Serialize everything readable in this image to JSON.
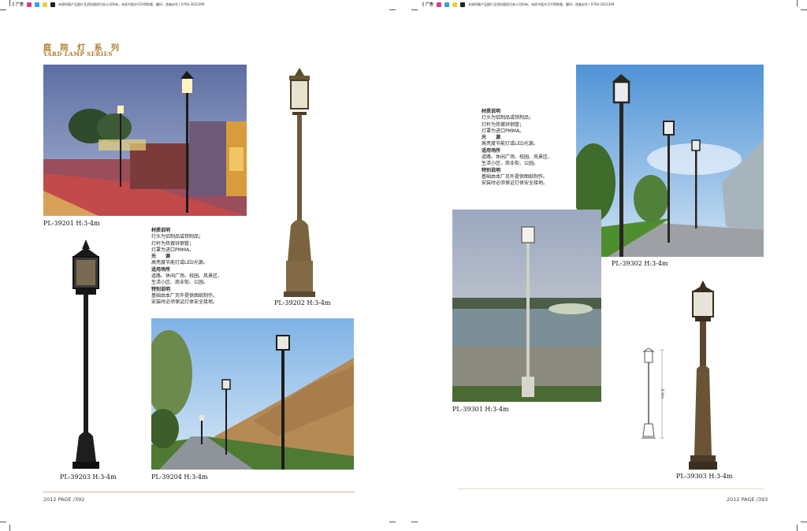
{
  "header": {
    "left": {
      "tag": "[ 广告",
      "notice": "本册所载产品图片及资料版权归本公司所有，未经书面许可不得转载、翻印，违者必究 | 0760-2615399"
    },
    "right": {
      "tag": "[ 广告",
      "notice": "本册所载产品图片及资料版权归本公司所有，未经书面许可不得转载、翻印，违者必究 | 0760-2615399"
    },
    "swatch_colors": [
      "#d93a8e",
      "#3aa0d9",
      "#e8d23a",
      "#222222"
    ]
  },
  "section": {
    "title_cn": "庭 院 灯 系 列",
    "title_en": "YARD LAMP SERIES",
    "accent": "#b07a2a"
  },
  "products": {
    "p39201": "PL-39201 H:3-4m",
    "p39202": "PL-39202 H:3-4m",
    "p39203": "PL-39203 H:3-4m",
    "p39204": "PL-39204 H:3-4m",
    "p39301": "PL-39301 H:3-4m",
    "p39302": "PL-39302 H:3-4m",
    "p39303": "PL-39303 H:3-4m"
  },
  "spec_left": {
    "h1": "材质说明",
    "l1": "灯头为铝制品或铁制品；",
    "l2": "灯杆为热镀锌钢管；",
    "l3": "灯罩为进口PMMA。",
    "h2": "光　　源",
    "l4": "高亮度节能灯或LED光源。",
    "h3": "适用场所",
    "l5": "道路、休闲广场、校园、风景区、",
    "l6": "生活小区、商业街、公园。",
    "h4": "特别说明",
    "l7": "基础由本厂另外提供图纸制作。",
    "l8": "安装时必须保证灯体安全接地。"
  },
  "spec_right": {
    "h1": "材质说明",
    "l1": "灯头为铝制品或铁制品；",
    "l2": "灯杆为热镀锌钢管；",
    "l3": "灯罩为进口PMMA。",
    "h2": "光　　源",
    "l4": "高亮度节能灯或LED光源。",
    "h3": "适用场所",
    "l5": "道路、休闲广场、校园、风景区、",
    "l6": "生活小区、商业街、公园。",
    "h4": "特别说明",
    "l7": "基础由本厂另外提供图纸制作。",
    "l8": "安装时必须保证灯体安全接地。"
  },
  "dimension_label": "3-4m",
  "footer": {
    "left_page": "2012 PAGE /392",
    "right_page": "2012 PAGE /393"
  }
}
